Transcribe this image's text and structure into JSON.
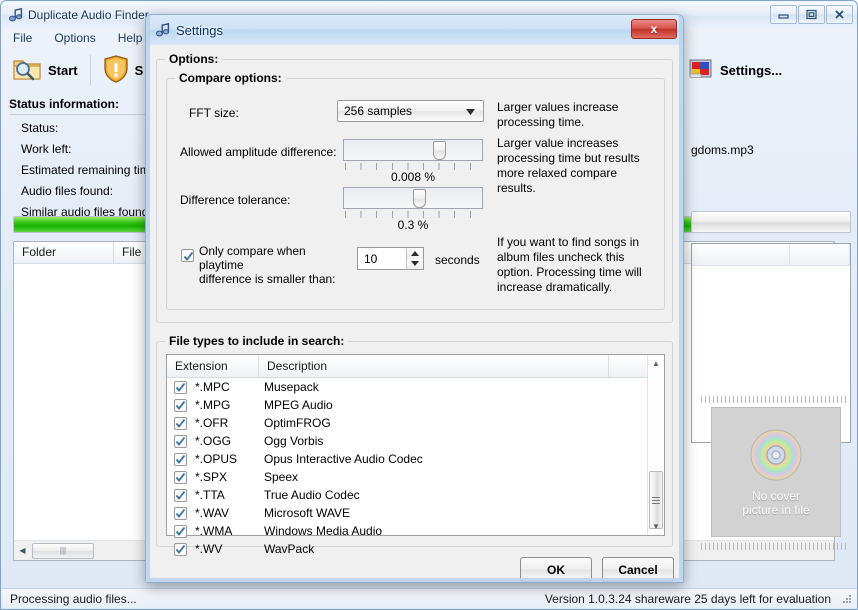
{
  "main_window": {
    "title": "Duplicate Audio Finder",
    "app_icon": "music-note-icon",
    "window_buttons": [
      {
        "name": "minimize-button",
        "glyph": "minimize-icon"
      },
      {
        "name": "maximize-button",
        "glyph": "maximize-icon"
      },
      {
        "name": "close-button",
        "glyph": "close-icon"
      }
    ],
    "menu": [
      "File",
      "Options",
      "Help"
    ],
    "toolbar": [
      {
        "name": "start-button",
        "label": "Start",
        "icon": "folder-search-icon"
      },
      {
        "name": "warning-button",
        "label": "S",
        "icon": "warning-shield-icon"
      },
      {
        "name": "settings-button",
        "label": "Settings...",
        "icon": "settings-picture-icon"
      }
    ],
    "status_group_title": "Status information:",
    "status_rows": [
      "Status:",
      "Work left:",
      "Estimated remaining time:",
      "Audio files found:",
      "Similar audio files found:"
    ],
    "grid_columns": [
      "Folder",
      "File name"
    ],
    "right_file_label": "gdoms.mp3",
    "cover_placeholder": {
      "line1": "No cover",
      "line2": "picture in file",
      "icon": "cd-disc-icon"
    },
    "statusbar": {
      "left": "Processing audio files...",
      "right": "Version 1.0.3.24 shareware 25 days left for evaluation"
    }
  },
  "dialog": {
    "title": "Settings",
    "icon": "music-note-icon",
    "close_label": "x",
    "options_group": "Options:",
    "compare_group": "Compare options:",
    "fft": {
      "label": "FFT size:",
      "value": "256 samples",
      "hint": "Larger values increase processing time."
    },
    "amplitude": {
      "label": "Allowed amplitude difference:",
      "value": "0.008 %",
      "thumb_pct": 71
    },
    "tolerance": {
      "label": "Difference tolerance:",
      "value": "0.3 %",
      "thumb_pct": 55,
      "hint": "Larger value increases processing time but results more relaxed compare results."
    },
    "playtime": {
      "label_line1": "Only compare when playtime",
      "label_line2": "difference is smaller than:",
      "checked": true,
      "value": "10",
      "unit": "seconds",
      "hint": "If you want to find songs in album files uncheck this option. Processing time will increase dramatically."
    },
    "filetypes_group": "File types to include in search:",
    "filetypes_columns": [
      "Extension",
      "Description"
    ],
    "filetypes": [
      {
        "ext": "*.MPC",
        "desc": "Musepack",
        "checked": true
      },
      {
        "ext": "*.MPG",
        "desc": "MPEG Audio",
        "checked": true
      },
      {
        "ext": "*.OFR",
        "desc": "OptimFROG",
        "checked": true
      },
      {
        "ext": "*.OGG",
        "desc": "Ogg Vorbis",
        "checked": true
      },
      {
        "ext": "*.OPUS",
        "desc": "Opus Interactive Audio Codec",
        "checked": true
      },
      {
        "ext": "*.SPX",
        "desc": "Speex",
        "checked": true
      },
      {
        "ext": "*.TTA",
        "desc": "True Audio Codec",
        "checked": true
      },
      {
        "ext": "*.WAV",
        "desc": "Microsoft WAVE",
        "checked": true
      },
      {
        "ext": "*.WMA",
        "desc": "Windows Media Audio",
        "checked": true
      },
      {
        "ext": "*.WV",
        "desc": "WavPack",
        "checked": true
      }
    ],
    "ok_label": "OK",
    "cancel_label": "Cancel"
  },
  "colors": {
    "accent": "#bed7f1",
    "close_red": "#c03129",
    "progress_green": "#19b203",
    "dialog_bg": "#f0f0f0"
  }
}
